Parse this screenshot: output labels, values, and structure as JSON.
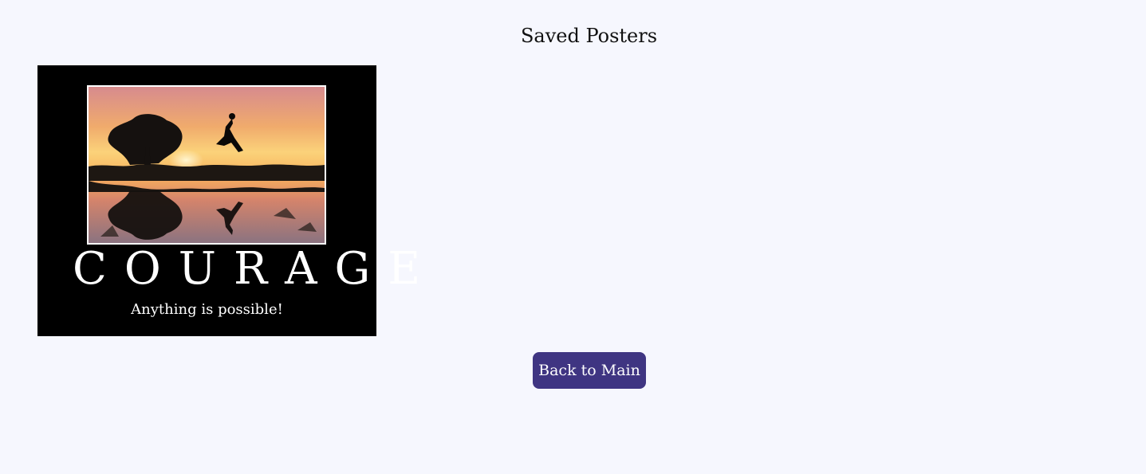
{
  "page": {
    "title": "Saved Posters"
  },
  "saved_posters": [
    {
      "title": "COURAGE",
      "quote": "Anything is possible!",
      "image_alt": "Silhouette of a person jumping beside a tree at sunset, reflected in water"
    }
  ],
  "back_button": {
    "label": "Back to Main"
  },
  "colors": {
    "background": "#f6f7fe",
    "poster_background": "#000000",
    "button": "#3f3582"
  }
}
